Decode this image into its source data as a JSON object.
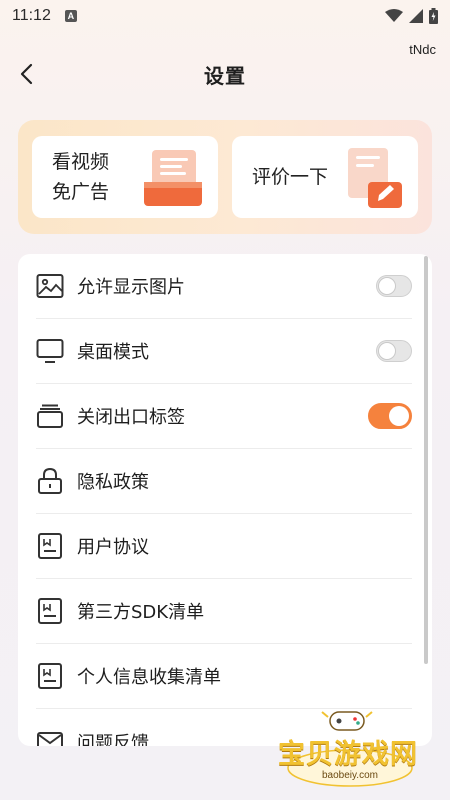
{
  "status_bar": {
    "time": "11:12",
    "notification_icon": "A"
  },
  "tag_text": "tNdc",
  "header": {
    "title": "设置"
  },
  "promo": {
    "ad_free_line1": "看视频",
    "ad_free_line2": "免广告",
    "review_label": "评价一下"
  },
  "settings": {
    "items": [
      {
        "label": "允许显示图片",
        "icon": "image-icon",
        "toggle": "off"
      },
      {
        "label": "桌面模式",
        "icon": "monitor-icon",
        "toggle": "off"
      },
      {
        "label": "关闭出口标签",
        "icon": "tabs-icon",
        "toggle": "on"
      },
      {
        "label": "隐私政策",
        "icon": "lock-icon"
      },
      {
        "label": "用户协议",
        "icon": "document-icon"
      },
      {
        "label": "第三方SDK清单",
        "icon": "document-icon"
      },
      {
        "label": "个人信息收集清单",
        "icon": "document-icon"
      },
      {
        "label": "问题反馈",
        "icon": "mail-icon"
      }
    ]
  },
  "watermark": {
    "title": "宝贝游戏网",
    "url": "baobeiy.com"
  },
  "colors": {
    "accent": "#f5823d",
    "card_bg": "#ffffff",
    "promo_bg": "#fbe6c8"
  }
}
